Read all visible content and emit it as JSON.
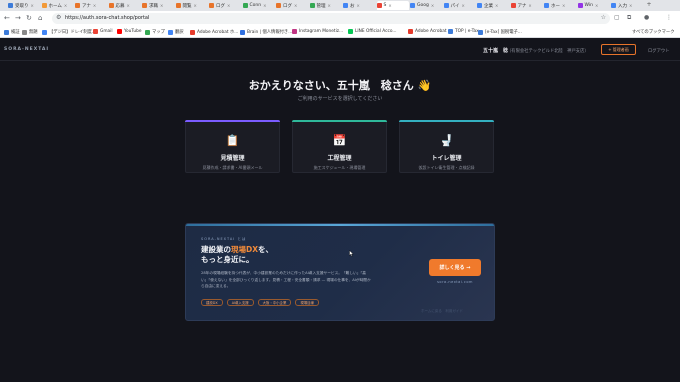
{
  "browser": {
    "tabs": [
      {
        "label": "受取り",
        "color": "#3c7bd9"
      },
      {
        "label": "ホーム",
        "color": "#f29a38"
      },
      {
        "label": "アナ",
        "color": "#e8742a"
      },
      {
        "label": "応募",
        "color": "#e8742a"
      },
      {
        "label": "求職",
        "color": "#e8742a"
      },
      {
        "label": "閲覧",
        "color": "#e8742a"
      },
      {
        "label": "ログ",
        "color": "#e8742a"
      },
      {
        "label": "Conn",
        "color": "#34a853"
      },
      {
        "label": "ログ",
        "color": "#e8742a"
      },
      {
        "label": "管理",
        "color": "#34a853"
      },
      {
        "label": "お",
        "color": "#4285f4"
      },
      {
        "label": "S",
        "color": "#ea4335"
      },
      {
        "label": "Goog",
        "color": "#4285f4"
      },
      {
        "label": "パイ",
        "color": "#4285f4"
      },
      {
        "label": "企業",
        "color": "#4285f4"
      },
      {
        "label": "アナ",
        "color": "#ea4335"
      },
      {
        "label": "ホー",
        "color": "#4285f4"
      },
      {
        "label": "Win",
        "color": "#9334e6"
      },
      {
        "label": "入力",
        "color": "#4285f4"
      }
    ],
    "url": "https://auth.sora-chat.shop/portal",
    "bookmarks": [
      {
        "label": "検証",
        "color": "#3c7bd9"
      },
      {
        "label": "無題",
        "color": "#888888"
      },
      {
        "label": "【デジ日】ドレイ制度...",
        "color": "#4285f4"
      },
      {
        "label": "Gmail",
        "color": "#ea4335"
      },
      {
        "label": "YouTube",
        "color": "#ff0000"
      },
      {
        "label": "マップ",
        "color": "#34a853"
      },
      {
        "label": "翻訳",
        "color": "#4285f4"
      },
      {
        "label": "Adobe Acrobat ホ...",
        "color": "#e53b2c"
      },
      {
        "label": "Brain | 個人情報付き...",
        "color": "#2f6fdf"
      },
      {
        "label": "Instagram Monetiz...",
        "color": "#c13584"
      },
      {
        "label": "LINE Official Acco...",
        "color": "#06c755"
      },
      {
        "label": "Adobe Acrobat",
        "color": "#e53b2c"
      },
      {
        "label": "TOP | e-Tax",
        "color": "#3c7bd9"
      },
      {
        "label": "[e-Tax] 国税電子...",
        "color": "#3c7bd9"
      }
    ],
    "all_bookmarks": "すべてのブックマーク"
  },
  "site": {
    "logo": "SORA-NEXTAI",
    "user_name": "五十嵐　稔",
    "company": "（有限会社テックビルド北陸　神戸支店）",
    "admin_button": "+ 管理者画",
    "logout": "ログアウト"
  },
  "welcome": {
    "title": "おかえりなさい、五十嵐　稔さん 👋",
    "subtitle": "ご利用のサービスを選択してください"
  },
  "services": [
    {
      "icon": "📋",
      "icon_name": "clipboard-icon",
      "title": "見積管理",
      "desc": "見積作成・請求書・AI番頭メール",
      "accent": "#7b5cff"
    },
    {
      "icon": "📅",
      "icon_name": "calendar-icon",
      "title": "工程管理",
      "desc": "施工スケジュール・現場管理",
      "accent": "#2fb89a"
    },
    {
      "icon": "🚽",
      "icon_name": "toilet-icon",
      "title": "トイレ管理",
      "desc": "仮設トイレ衛生管理・点検記録",
      "accent": "#34b0c0"
    }
  ],
  "promo": {
    "eyebrow": "SORA-NEXTAI とは",
    "headline_prefix": "建設業の",
    "headline_highlight": "現場DX",
    "headline_suffix": "を、",
    "headline_line2": "もっと身近に。",
    "body": "28年の現場経験を持つ代表が、中小建設業のためだけに作ったAI導入支援サービス。「難しい」「高い」「使えない」を全部ひっくり返します。見積・工程・安全書類・請求 — 現場の仕事を、AIが時間から自由に変える。",
    "chips": [
      "建設DX",
      "AI導入支援",
      "大阪・中小企業",
      "現場目線"
    ],
    "cta": "詳しく見る →",
    "domain": "sora-nextai.com",
    "faint_text": "ホームに戻る　利用ガイド"
  },
  "colors": {
    "page_bg": "#13141b",
    "accent_orange": "#f07a2c",
    "card_bg": "#1b1c24",
    "promo_bg": "#1f2d48"
  }
}
